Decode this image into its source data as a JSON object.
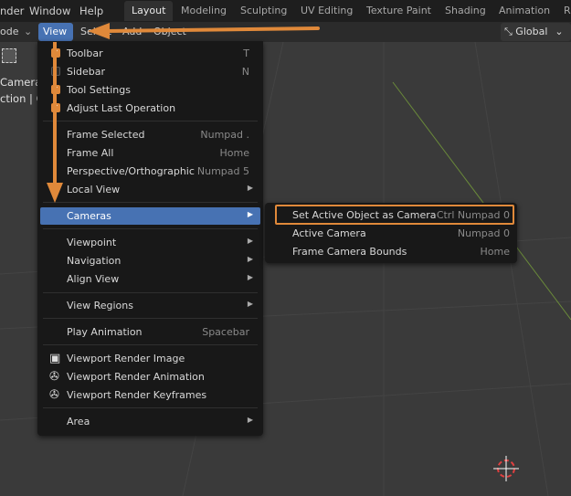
{
  "topbar": {
    "menus": [
      "nder",
      "Window",
      "Help"
    ],
    "workspaces": [
      "Layout",
      "Modeling",
      "Sculpting",
      "UV Editing",
      "Texture Paint",
      "Shading",
      "Animation",
      "R"
    ]
  },
  "header": {
    "mode": "ode",
    "menus": [
      "View",
      "Select",
      "Add",
      "Object"
    ],
    "orientation": "Global"
  },
  "overlay_text": {
    "object": "Camera",
    "collection": "ction | Ca"
  },
  "view_menu": {
    "toggles": [
      {
        "label": "Toolbar",
        "shortcut": "T",
        "checked": true
      },
      {
        "label": "Sidebar",
        "shortcut": "N",
        "checked": false
      },
      {
        "label": "Tool Settings",
        "shortcut": "",
        "checked": true
      },
      {
        "label": "Adjust Last Operation",
        "shortcut": "",
        "checked": true
      }
    ],
    "frame": [
      {
        "label": "Frame Selected",
        "shortcut": "Numpad ."
      },
      {
        "label": "Frame All",
        "shortcut": "Home"
      },
      {
        "label": "Perspective/Orthographic",
        "shortcut": "Numpad 5"
      },
      {
        "label": "Local View",
        "shortcut": ""
      }
    ],
    "cameras": "Cameras",
    "nav": [
      "Viewpoint",
      "Navigation",
      "Align View"
    ],
    "view_regions": "View Regions",
    "play": {
      "label": "Play Animation",
      "shortcut": "Spacebar"
    },
    "render": [
      "Viewport Render Image",
      "Viewport Render Animation",
      "Viewport Render Keyframes"
    ],
    "area": "Area"
  },
  "cameras_submenu": [
    {
      "label": "Set Active Object as Camera",
      "shortcut": "Ctrl Numpad 0"
    },
    {
      "label": "Active Camera",
      "shortcut": "Numpad 0"
    },
    {
      "label": "Frame Camera Bounds",
      "shortcut": "Home"
    }
  ],
  "colors": {
    "accent": "#4772b3",
    "highlight": "#e0893a"
  }
}
